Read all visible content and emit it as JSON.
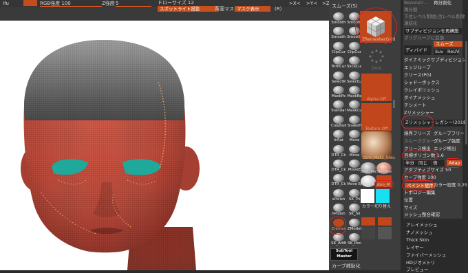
{
  "topbar": {
    "ifu_label": "Ifu",
    "rgb_label": "RGB強度 100",
    "z_label": "Z強度",
    "z_value": "5",
    "draw_size_label": "ドローサイズ 12",
    "spotlight_btn": "スポットライト投影",
    "sym_mask_label": "背面マスク",
    "sym_btn": "マスク表示",
    "r_label": "(R)",
    "xplus": ">X<",
    "yplus": ">Y<",
    "zplus": ">Z<"
  },
  "palette": {
    "header": "スムーズ(S)",
    "brushes": [
      [
        "Smooth",
        "Smooth"
      ],
      [
        "Smooth",
        "Smooth"
      ],
      [
        "ClipCur",
        "ClipCur"
      ],
      [
        "TrimCur",
        "SliceCur"
      ],
      [
        "SelectR",
        "SelectLa"
      ],
      [
        "MaskPe",
        "MaskRe"
      ],
      [
        "Standar",
        "MaskCu"
      ],
      [
        "ClayBuil",
        "SnakeH"
      ],
      [
        "Inflat",
        "Move"
      ],
      [
        "DTR_Ck",
        "Move"
      ],
      [
        "DTR_Ck",
        "MoveE"
      ],
      [
        "DTR_Ck",
        "Move El"
      ],
      [
        "sPolish",
        "SK_Tri"
      ],
      [
        "hPolish",
        "SK_Sli"
      ],
      [
        "Zremes",
        "ZModel"
      ],
      [
        "SK_ArtB",
        "SK_Pen"
      ]
    ],
    "material_label": "ZRemesherGuid",
    "dots_label": "Dots",
    "alpha_label": "Alpha Off",
    "texture_label": "Texture Off",
    "mat_label": "zbro_Mat2_bleu",
    "basicmat_label": "BasicMa",
    "skinsha_label": "SkinSha",
    "flatcol_label": "Flat Col",
    "zbro_label": "zbro_M",
    "color_switch": "カラー切り替え",
    "subtool_master": "SubTool Master",
    "curve_assist": "カーブ補助化"
  },
  "rpanel": {
    "top_rows": [
      "Reconstr…",
      "再分割",
      "下位レベル削除",
      "上位レベル削除",
      "凍結化"
    ],
    "top_right": "再分割化",
    "resub_btn": "サブディビジョンを再構築",
    "convert_btn": "ポリグループに変換",
    "divide": "ディバイド",
    "smooth_btn": "スムーズ",
    "suv": "Suv",
    "relax": "ReUV",
    "dynamesh_sub": "ダイナミックサブディビジョン",
    "edgeloop": "エッジループ",
    "crease": "クリース(PG)",
    "shadowbox": "シャドーボックス",
    "claypolish": "クレイポリッシュ",
    "dynamesh": "ダイナメッシュ",
    "tessimate": "テシメート",
    "zremesher": "Zリメッシャー",
    "zremesher_btn": "Zリメッシャー",
    "legacy_btn": "レガシー(2018)",
    "keep_groups": "境界フリーズ",
    "group_free": "グループフリー",
    "smooth_groups": "スムーズグループ",
    "group_color": "グループ強度",
    "crease_detect": "クリース検出",
    "edge_detect": "エッジ検出",
    "target_poly": "目標ポリゴン数 1.6",
    "half": "半分",
    "same": "同じ",
    "double": "倍",
    "adapt": "Adapt",
    "adaptive_size": "アダプティブサイズ 50",
    "curve_strength": "カーブ強度 100",
    "use_paint": "ペイント使用",
    "color_density": "カラー密度 0.25",
    "topology": "トポロジー編集",
    "position": "位置",
    "size": "サイズ",
    "mesh_integrity": "メッシュ整合確認",
    "lower": [
      "アレイメッシュ",
      "ナノメッシュ",
      "Thick Skin",
      "レイヤー",
      "ファイバーメッシュ",
      "HDジオメトリ",
      "プレビュー"
    ]
  },
  "colors": {
    "accent": "#d9541e",
    "mesh": "#b84a3b",
    "eyes": "#1ea99b",
    "highlight": "#e32020"
  }
}
